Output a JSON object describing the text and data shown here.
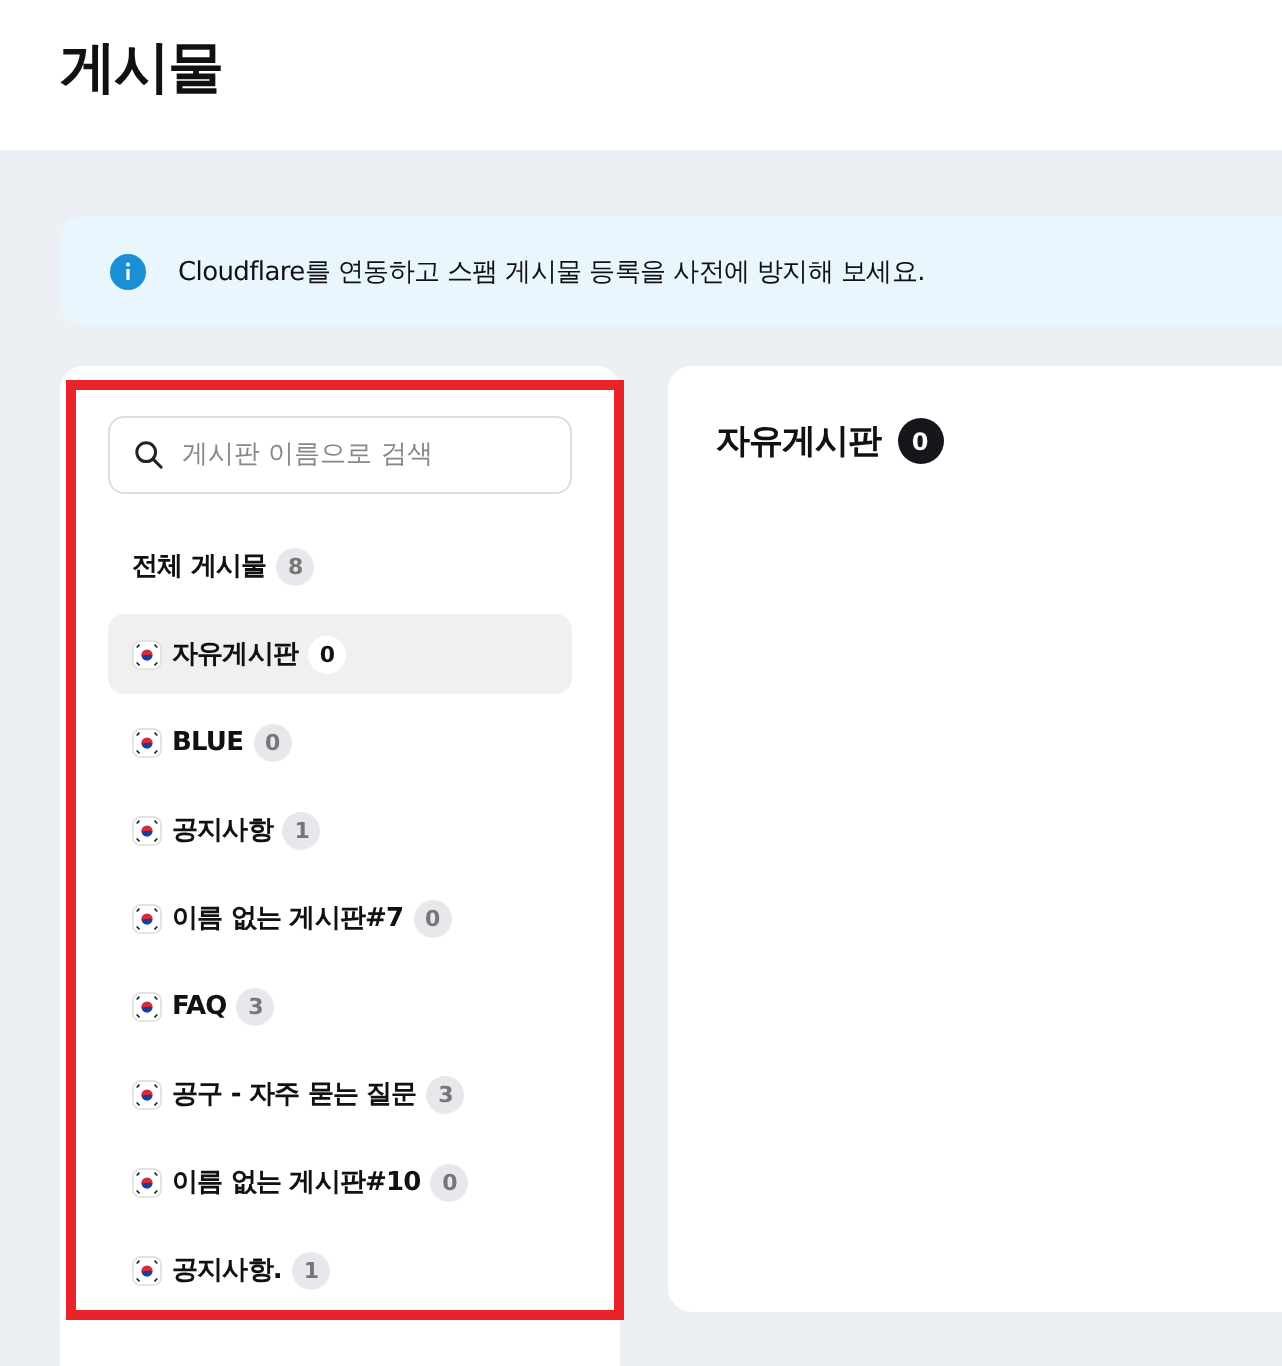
{
  "page_title": "게시물",
  "notice": {
    "text": "Cloudflare를 연동하고 스팸 게시물 등록을 사전에 방지해 보세요."
  },
  "search": {
    "placeholder": "게시판 이름으로 검색"
  },
  "all_posts": {
    "label": "전체 게시물",
    "count": "8"
  },
  "boards": [
    {
      "name": "자유게시판",
      "count": "0",
      "selected": true
    },
    {
      "name": "BLUE",
      "count": "0",
      "selected": false
    },
    {
      "name": "공지사항",
      "count": "1",
      "selected": false
    },
    {
      "name": "이름 없는 게시판#7",
      "count": "0",
      "selected": false
    },
    {
      "name": "FAQ",
      "count": "3",
      "selected": false
    },
    {
      "name": "공구 - 자주 묻는 질문",
      "count": "3",
      "selected": false
    },
    {
      "name": "이름 없는 게시판#10",
      "count": "0",
      "selected": false
    },
    {
      "name": "공지사항.",
      "count": "1",
      "selected": false
    }
  ],
  "board_view": {
    "title": "자유게시판",
    "count": "0"
  },
  "highlight_frame": true
}
